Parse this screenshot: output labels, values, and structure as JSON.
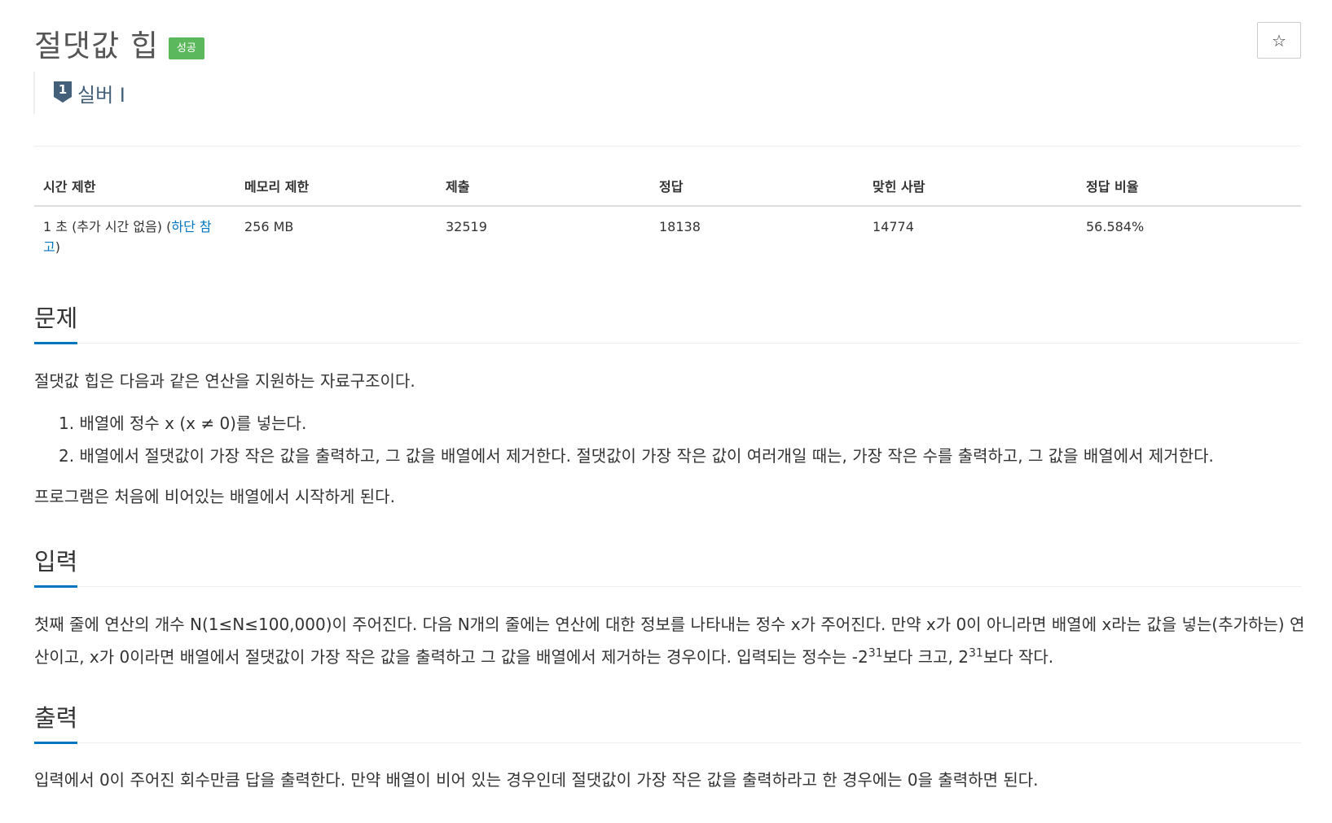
{
  "problem": {
    "title": "절댓값 힙",
    "status_badge": "성공",
    "tier_number": "1",
    "tier_label": "실버 I",
    "star_icon": "☆"
  },
  "stats": {
    "headers": [
      "시간 제한",
      "메모리 제한",
      "제출",
      "정답",
      "맞힌 사람",
      "정답 비율"
    ],
    "time_limit_text": "1 초 (추가 시간 없음) (",
    "time_limit_link": "하단 참고",
    "time_limit_close": ")",
    "memory_limit": "256 MB",
    "submissions": "32519",
    "accepted": "18138",
    "solvers": "14774",
    "ratio": "56.584%"
  },
  "sections": {
    "problem_title": "문제",
    "problem_intro": "절댓값 힙은 다음과 같은 연산을 지원하는 자료구조이다.",
    "problem_items": [
      "1. 배열에 정수 x (x ≠ 0)를 넣는다.",
      "2. 배열에서 절댓값이 가장 작은 값을 출력하고, 그 값을 배열에서 제거한다. 절댓값이 가장 작은 값이 여러개일 때는, 가장 작은 수를 출력하고, 그 값을 배열에서 제거한다."
    ],
    "problem_outro": "프로그램은 처음에 비어있는 배열에서 시작하게 된다.",
    "input_title": "입력",
    "input_text_1": "첫째 줄에 연산의 개수 N(1≤N≤100,000)이 주어진다. 다음 N개의 줄에는 연산에 대한 정보를 나타내는 정수 x가 주어진다. 만약 x가 0이 아니라면 배열에 x라는 값을 넣는(추가하는) 연산이고, x가 0이라면 배열에서 절댓값이 가장 작은 값을 출력하고 그 값을 배열에서 제거하는 경우이다. 입력되는 정수는 -2",
    "input_exp_1": "31",
    "input_text_2": "보다 크고, 2",
    "input_exp_2": "31",
    "input_text_3": "보다 작다.",
    "output_title": "출력",
    "output_text": "입력에서 0이 주어진 회수만큼 답을 출력한다. 만약 배열이 비어 있는 경우인데 절댓값이 가장 작은 값을 출력하라고 한 경우에는 0을 출력하면 된다."
  },
  "colors": {
    "accent": "#0076c0",
    "success": "#5cb85c",
    "tier": "#435f7a"
  }
}
